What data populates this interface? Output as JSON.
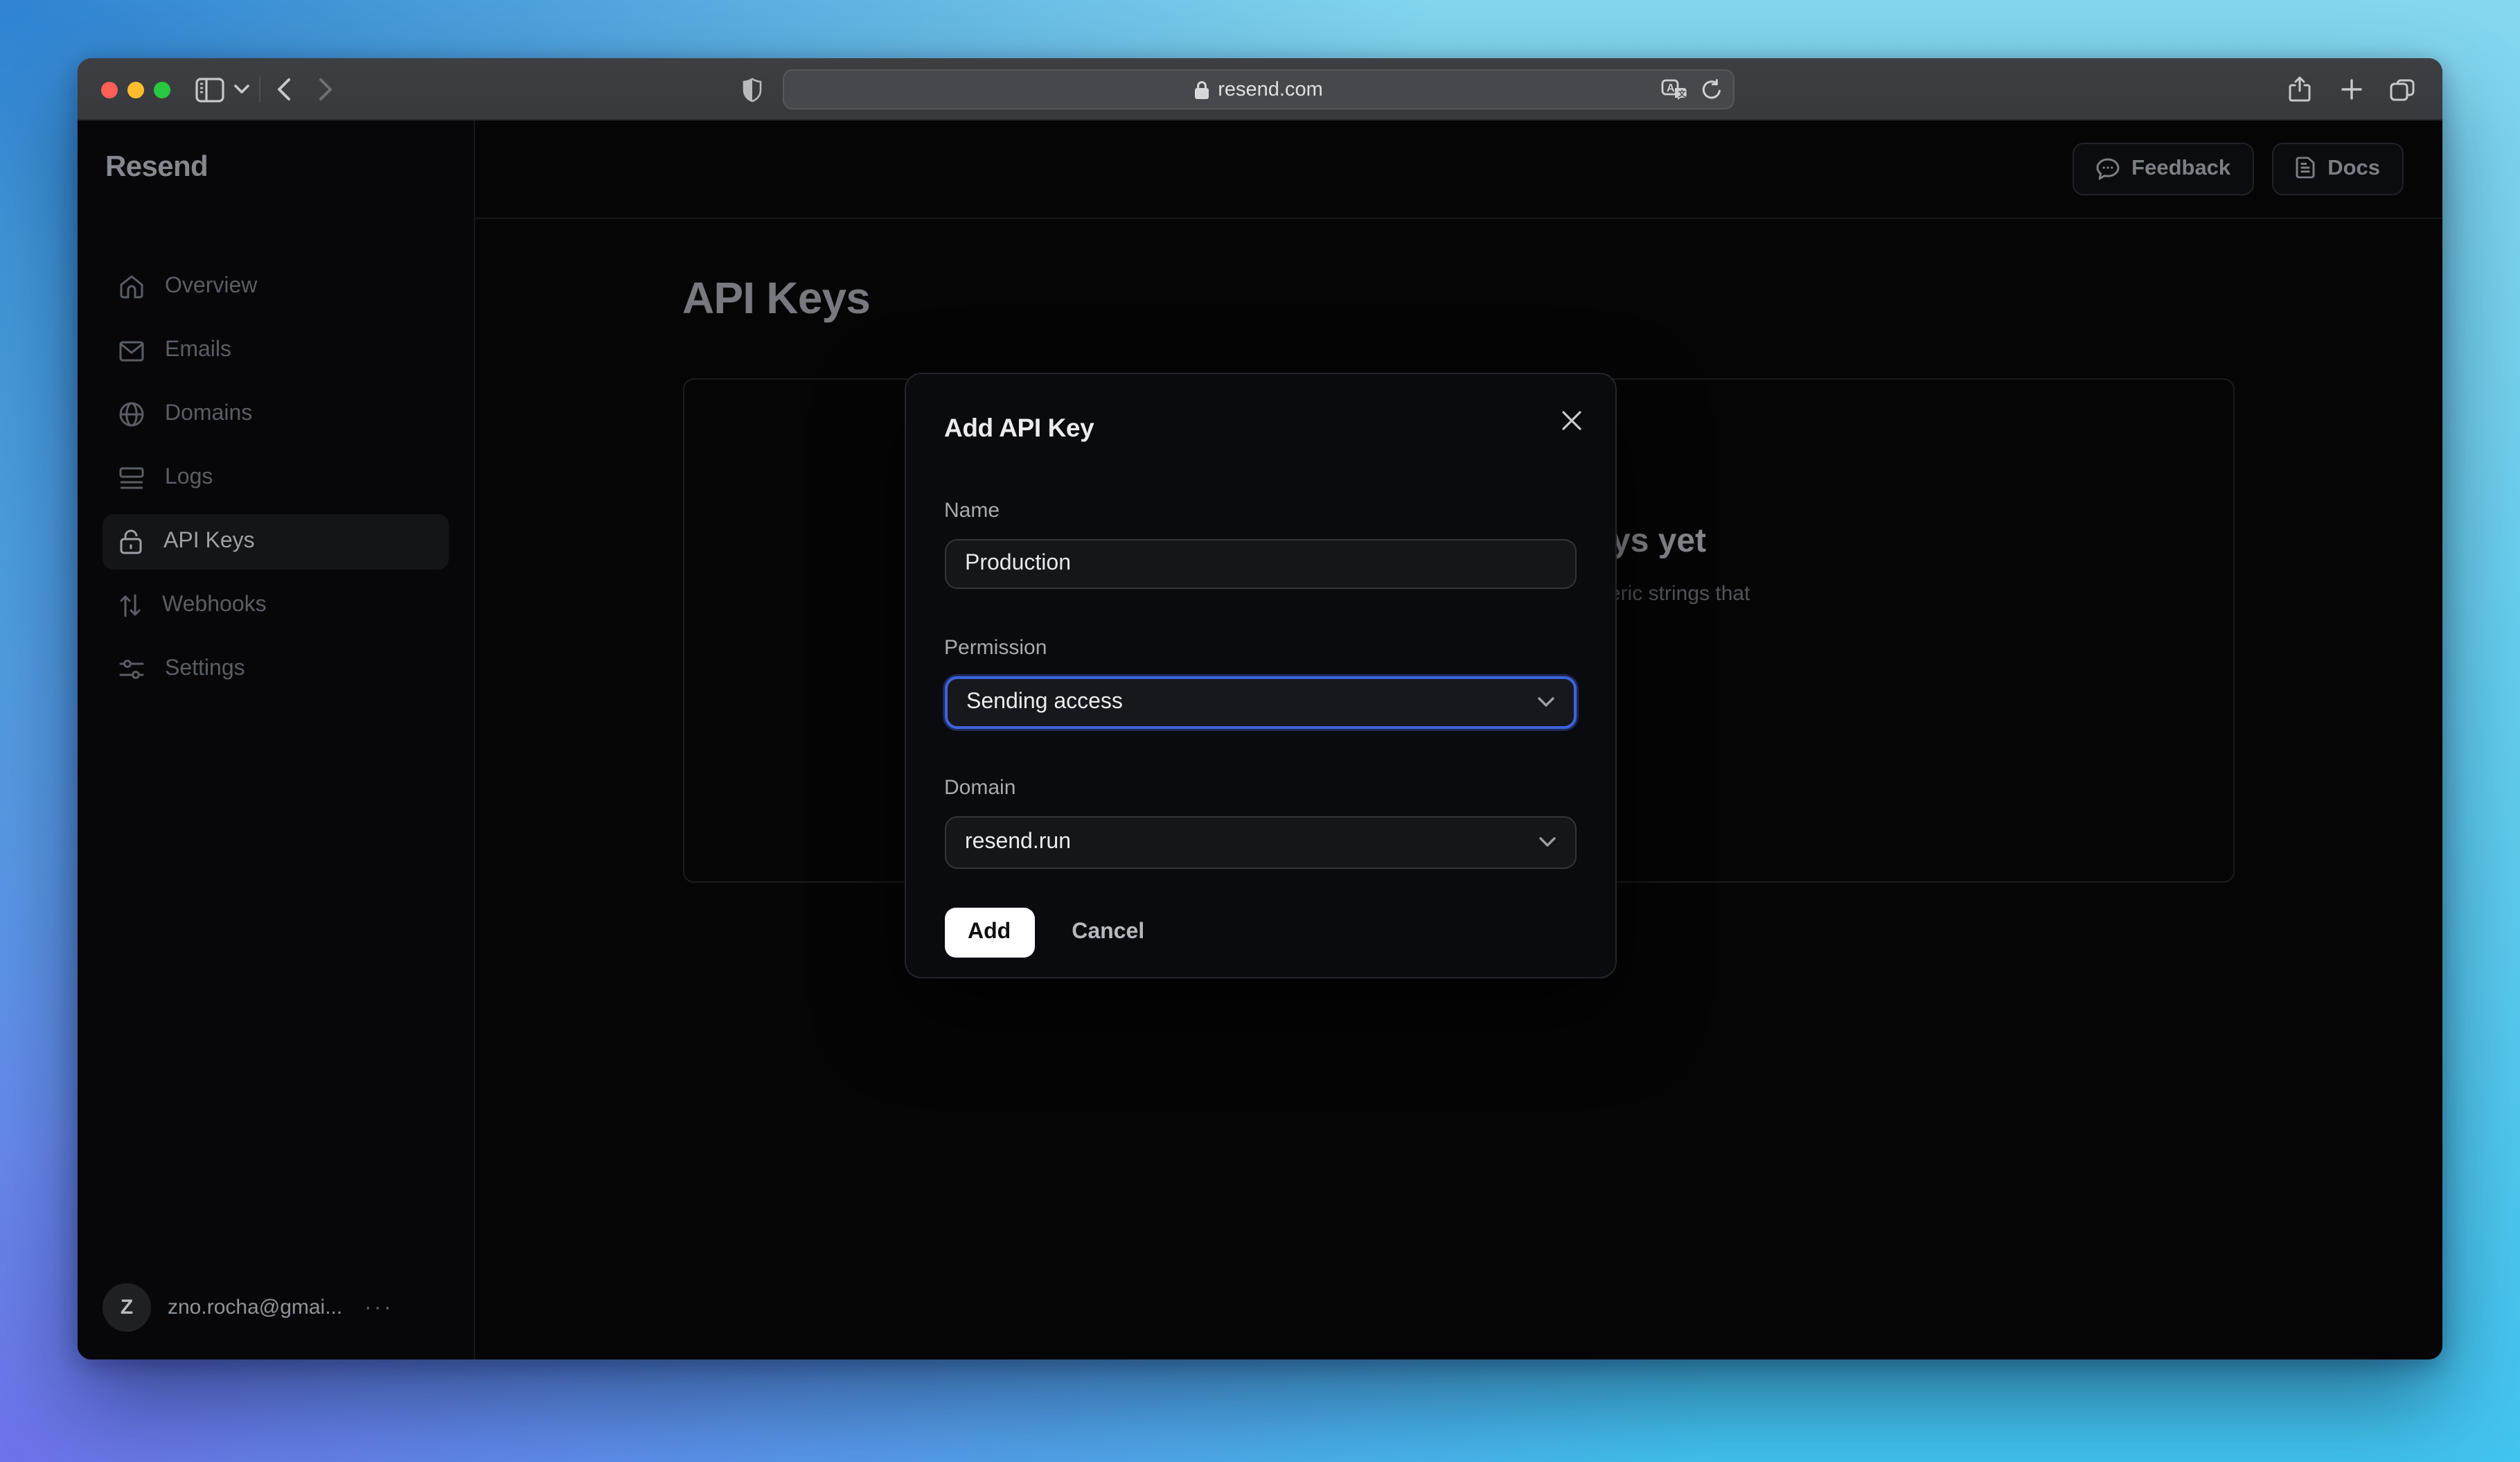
{
  "browser": {
    "url_host": "resend.com"
  },
  "sidebar": {
    "logo": "Resend",
    "items": [
      {
        "label": "Overview",
        "icon": "home-icon",
        "active": false
      },
      {
        "label": "Emails",
        "icon": "mail-icon",
        "active": false
      },
      {
        "label": "Domains",
        "icon": "globe-icon",
        "active": false
      },
      {
        "label": "Logs",
        "icon": "logs-icon",
        "active": false
      },
      {
        "label": "API Keys",
        "icon": "lock-icon",
        "active": true
      },
      {
        "label": "Webhooks",
        "icon": "webhooks-icon",
        "active": false
      },
      {
        "label": "Settings",
        "icon": "settings-icon",
        "active": false
      }
    ],
    "user": {
      "avatar_initial": "Z",
      "email": "zno.rocha@gmai...",
      "menu": "···"
    }
  },
  "header": {
    "feedback": "Feedback",
    "docs": "Docs"
  },
  "page": {
    "title": "API Keys",
    "empty_state_heading_fragment": "ys yet",
    "empty_state_description_fragment": "eric strings that"
  },
  "modal": {
    "title": "Add API Key",
    "name_label": "Name",
    "name_value": "Production",
    "permission_label": "Permission",
    "permission_value": "Sending access",
    "domain_label": "Domain",
    "domain_value": "resend.run",
    "add_label": "Add",
    "cancel_label": "Cancel"
  },
  "colors": {
    "accent_focus": "#3e63dd",
    "traffic_red": "#ff5f57",
    "traffic_yellow": "#febc2e",
    "traffic_green": "#28c840",
    "add_button_bg": "#ffffff"
  }
}
